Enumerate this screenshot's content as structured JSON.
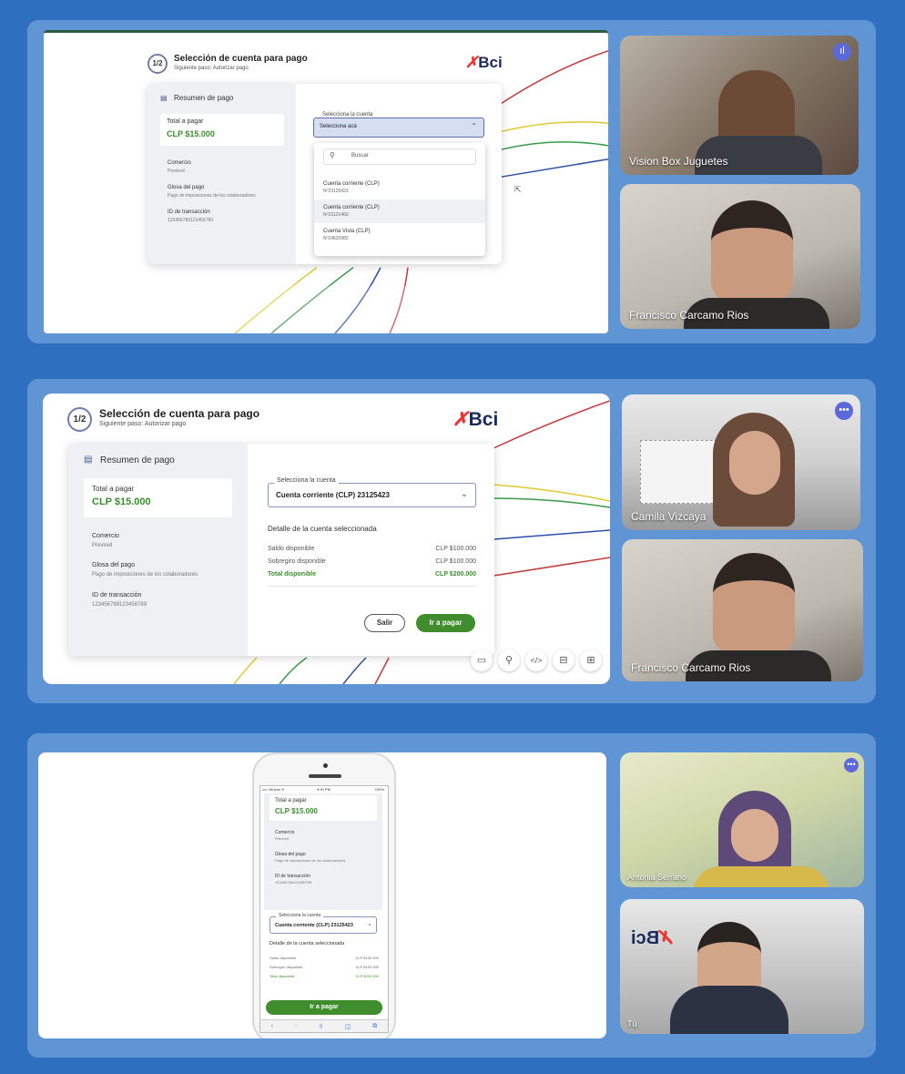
{
  "app": {
    "step": "1/2",
    "title": "Selección de cuenta para pago",
    "subtitle": "Siguiente paso: Autorizar pago",
    "logo": "Bci",
    "summary_title": "Resumen de pago",
    "total_label": "Total a pagar",
    "total_value": "CLP $15.000",
    "merchant_label": "Comercio",
    "merchant_value": "Previred",
    "desc_label": "Glosa del pago",
    "desc_value": "Pago de imposiciones de los colaboradores",
    "txn_label": "ID de transacción",
    "txn_value": "123456789123456789",
    "select_legend": "Selecciona la cuenta",
    "select_placeholder": "Selecciona acá",
    "select_value": "Cuenta corriente (CLP) 23125423",
    "search_placeholder": "Buscar",
    "accounts": [
      {
        "name": "Cuenta corriente (CLP)",
        "number": "Nº23125423"
      },
      {
        "name": "Cuenta corriente (CLP)",
        "number": "Nº23121460"
      },
      {
        "name": "Cuenta Vista (CLP)",
        "number": "Nº24625982"
      }
    ],
    "detail_title": "Detalle de la cuenta seleccionada",
    "available_label": "Saldo disponible",
    "available_value": "CLP $100.000",
    "overdraft_label": "Sobregiro disponible",
    "overdraft_value": "CLP $100.000",
    "total_available_label": "Total disponible",
    "total_available_value": "CLP $200.000",
    "exit_button": "Salir",
    "pay_button": "Ir a pagar"
  },
  "phone": {
    "carrier": "•••• Verizon ✈",
    "clock": "9:00 PM",
    "battery": "100%",
    "select_value": "Cuenta corriente (CLP) 23125423"
  },
  "participants": {
    "p1": "Vision Box Juguetes",
    "p2": "Francisco Carcamo Rios",
    "p3": "Camila Vizcaya",
    "p4": "Francisco Carcamo Rios",
    "p5": "Antonia Serrano",
    "p6": "Tú"
  },
  "icons": {
    "more": "more-options-icon",
    "audio": "audio-level-icon",
    "cursor": "mouse-pointer-icon"
  },
  "colors": {
    "background": "#2f6fbf",
    "panel": "#5f95d4",
    "green_button": "#3f8d2c",
    "dots_badge": "#5b6ad8"
  }
}
